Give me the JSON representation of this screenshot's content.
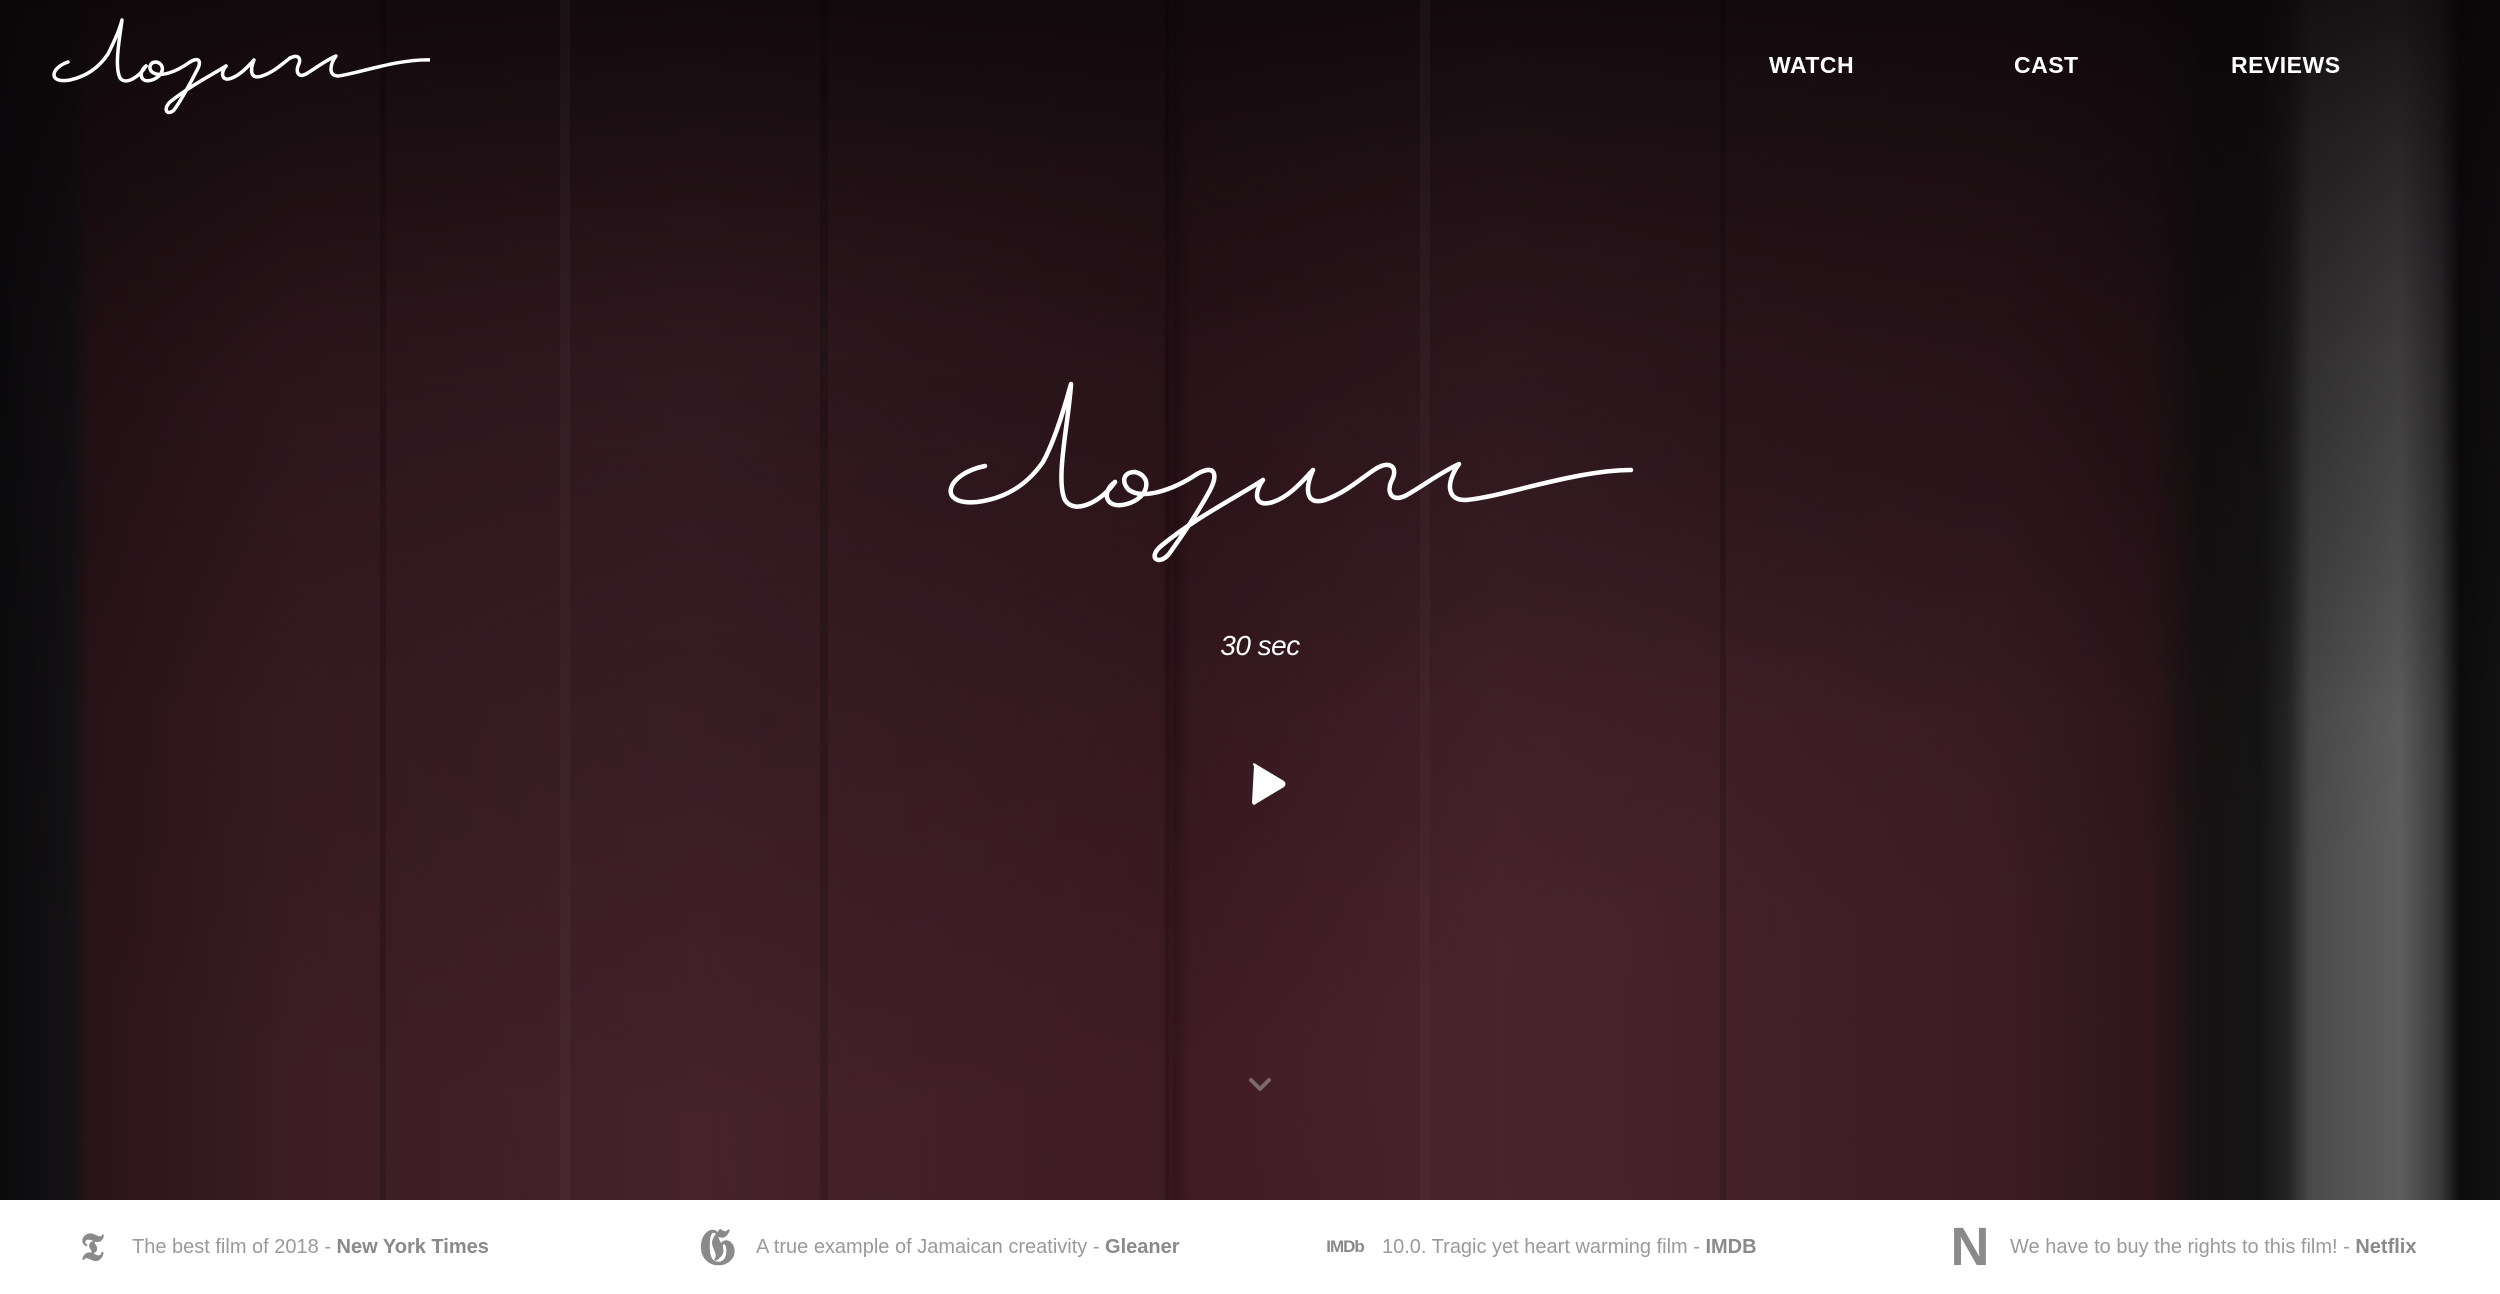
{
  "brand": {
    "logo_text": "closure",
    "hero_title": "closure"
  },
  "nav": {
    "items": [
      {
        "label": "WATCH"
      },
      {
        "label": "CAST"
      },
      {
        "label": "REVIEWS"
      }
    ]
  },
  "hero": {
    "duration": "30 sec",
    "play_icon": "play-icon",
    "scroll_icon": "chevron-down-icon"
  },
  "reviews": [
    {
      "icon": "new-york-times-icon",
      "icon_glyph": "𝕿",
      "quote": "The best film of 2018 - ",
      "source": "New York Times"
    },
    {
      "icon": "gleaner-icon",
      "icon_glyph": "𝕲",
      "quote": "A true example of Jamaican creativity - ",
      "source": "Gleaner"
    },
    {
      "icon": "imdb-icon",
      "icon_glyph": "IMDb",
      "quote": "10.0. Tragic yet heart warming film - ",
      "source": "IMDB"
    },
    {
      "icon": "netflix-icon",
      "icon_glyph": "N",
      "quote": "We have to buy the rights to this film! - ",
      "source": "Netflix"
    }
  ],
  "colors": {
    "curtain": "#43222b",
    "review_strip_bg": "#ffffff",
    "review_text": "#9a9a9a",
    "nav_text": "#ffffff"
  }
}
